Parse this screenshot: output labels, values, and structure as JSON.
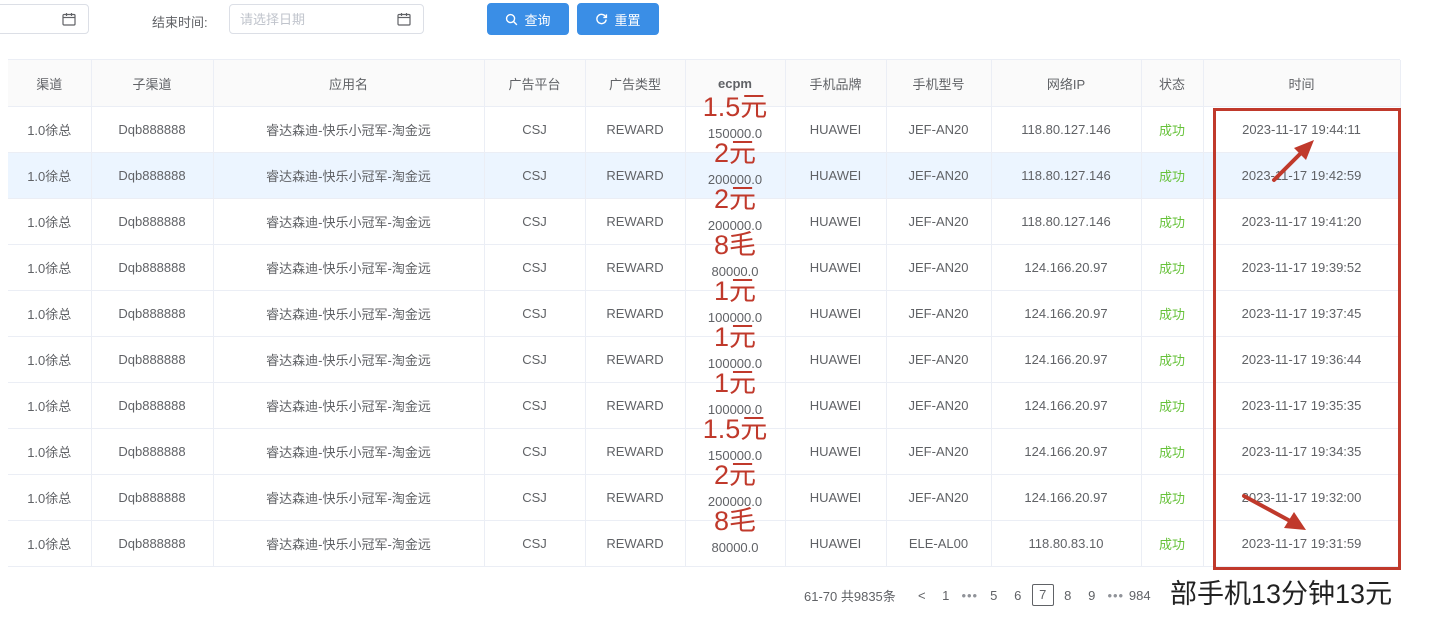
{
  "filters": {
    "end_label": "结束时间:",
    "end_placeholder": "请选择日期",
    "search_label": "查询",
    "reset_label": "重置"
  },
  "table": {
    "headers": [
      "渠道",
      "子渠道",
      "应用名",
      "广告平台",
      "广告类型",
      "ecpm",
      "手机品牌",
      "手机型号",
      "网络IP",
      "状态",
      "时间"
    ],
    "rows": [
      [
        "1.0徐总",
        "Dqb888888",
        "睿达森迪-快乐小冠军-淘金远",
        "CSJ",
        "REWARD",
        "150000.0",
        "HUAWEI",
        "JEF-AN20",
        "118.80.127.146",
        "成功",
        "2023-11-17 19:44:11"
      ],
      [
        "1.0徐总",
        "Dqb888888",
        "睿达森迪-快乐小冠军-淘金远",
        "CSJ",
        "REWARD",
        "200000.0",
        "HUAWEI",
        "JEF-AN20",
        "118.80.127.146",
        "成功",
        "2023-11-17 19:42:59"
      ],
      [
        "1.0徐总",
        "Dqb888888",
        "睿达森迪-快乐小冠军-淘金远",
        "CSJ",
        "REWARD",
        "200000.0",
        "HUAWEI",
        "JEF-AN20",
        "118.80.127.146",
        "成功",
        "2023-11-17 19:41:20"
      ],
      [
        "1.0徐总",
        "Dqb888888",
        "睿达森迪-快乐小冠军-淘金远",
        "CSJ",
        "REWARD",
        "80000.0",
        "HUAWEI",
        "JEF-AN20",
        "124.166.20.97",
        "成功",
        "2023-11-17 19:39:52"
      ],
      [
        "1.0徐总",
        "Dqb888888",
        "睿达森迪-快乐小冠军-淘金远",
        "CSJ",
        "REWARD",
        "100000.0",
        "HUAWEI",
        "JEF-AN20",
        "124.166.20.97",
        "成功",
        "2023-11-17 19:37:45"
      ],
      [
        "1.0徐总",
        "Dqb888888",
        "睿达森迪-快乐小冠军-淘金远",
        "CSJ",
        "REWARD",
        "100000.0",
        "HUAWEI",
        "JEF-AN20",
        "124.166.20.97",
        "成功",
        "2023-11-17 19:36:44"
      ],
      [
        "1.0徐总",
        "Dqb888888",
        "睿达森迪-快乐小冠军-淘金远",
        "CSJ",
        "REWARD",
        "100000.0",
        "HUAWEI",
        "JEF-AN20",
        "124.166.20.97",
        "成功",
        "2023-11-17 19:35:35"
      ],
      [
        "1.0徐总",
        "Dqb888888",
        "睿达森迪-快乐小冠军-淘金远",
        "CSJ",
        "REWARD",
        "150000.0",
        "HUAWEI",
        "JEF-AN20",
        "124.166.20.97",
        "成功",
        "2023-11-17 19:34:35"
      ],
      [
        "1.0徐总",
        "Dqb888888",
        "睿达森迪-快乐小冠军-淘金远",
        "CSJ",
        "REWARD",
        "200000.0",
        "HUAWEI",
        "JEF-AN20",
        "124.166.20.97",
        "成功",
        "2023-11-17 19:32:00"
      ],
      [
        "1.0徐总",
        "Dqb888888",
        "睿达森迪-快乐小冠军-淘金远",
        "CSJ",
        "REWARD",
        "80000.0",
        "HUAWEI",
        "ELE-AL00",
        "118.80.83.10",
        "成功",
        "2023-11-17 19:31:59"
      ]
    ],
    "highlighted_row": 1
  },
  "annotations": {
    "ecpm_notes": [
      "1.5元",
      "2元",
      "2元",
      "8毛",
      "1元",
      "1元",
      "1元",
      "1.5元",
      "2元",
      "8毛"
    ],
    "caption": "部手机13分钟13元",
    "color": "#c0392b"
  },
  "pagination": {
    "total": "61-70 共9835条",
    "prev": "<",
    "pages_before": [
      "1"
    ],
    "dots": "•••",
    "pages": [
      "5",
      "6",
      "7",
      "8",
      "9"
    ],
    "active": "7",
    "pages_after": [
      "984"
    ]
  },
  "colors": {
    "primary": "#3a8ee6",
    "success": "#67c23a",
    "highlight_row": "#ecf5ff",
    "annotation": "#c0392b"
  }
}
